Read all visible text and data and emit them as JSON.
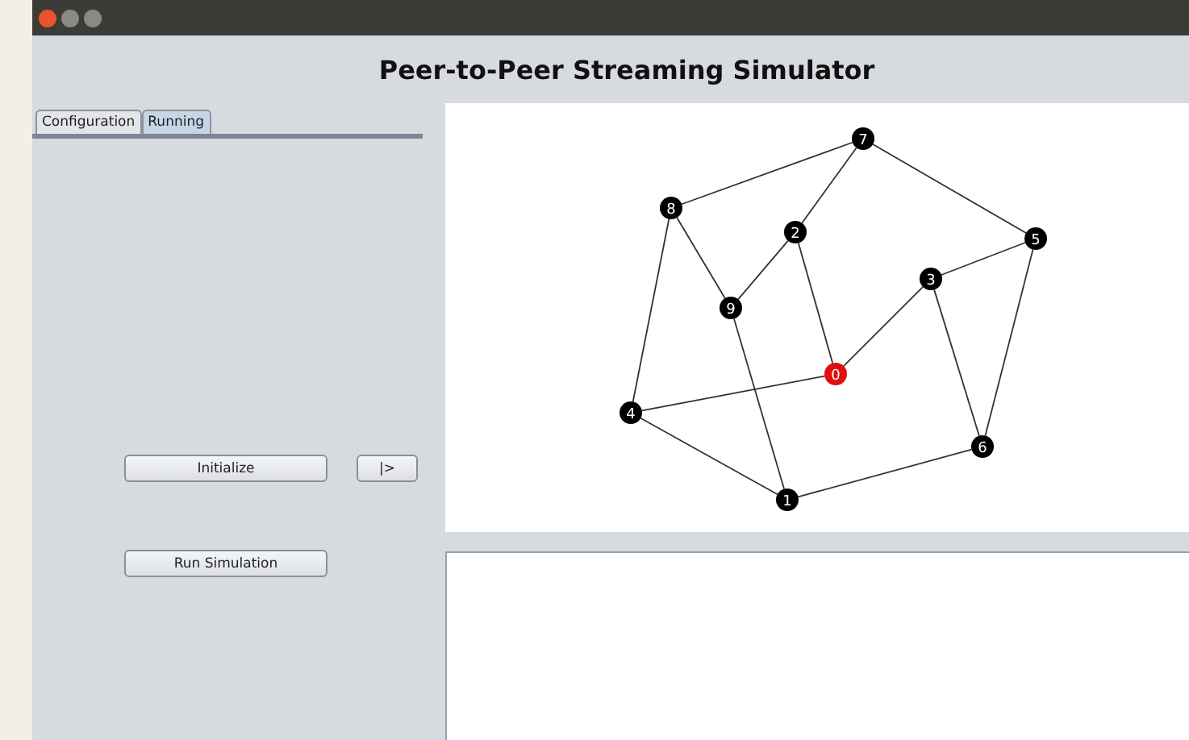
{
  "heading": "Peer-to-Peer Streaming Simulator",
  "tabs": [
    {
      "label": "Configuration",
      "selected": false
    },
    {
      "label": "Running",
      "selected": true
    }
  ],
  "buttons": {
    "initialize": "Initialize",
    "step": "|>",
    "run": "Run Simulation"
  },
  "graph": {
    "nodes": [
      {
        "label": "0",
        "color": "#e01010"
      },
      {
        "label": "1",
        "color": "#000000"
      },
      {
        "label": "2",
        "color": "#000000"
      },
      {
        "label": "3",
        "color": "#000000"
      },
      {
        "label": "4",
        "color": "#000000"
      },
      {
        "label": "5",
        "color": "#000000"
      },
      {
        "label": "6",
        "color": "#000000"
      },
      {
        "label": "7",
        "color": "#000000"
      },
      {
        "label": "8",
        "color": "#000000"
      },
      {
        "label": "9",
        "color": "#000000"
      }
    ]
  }
}
